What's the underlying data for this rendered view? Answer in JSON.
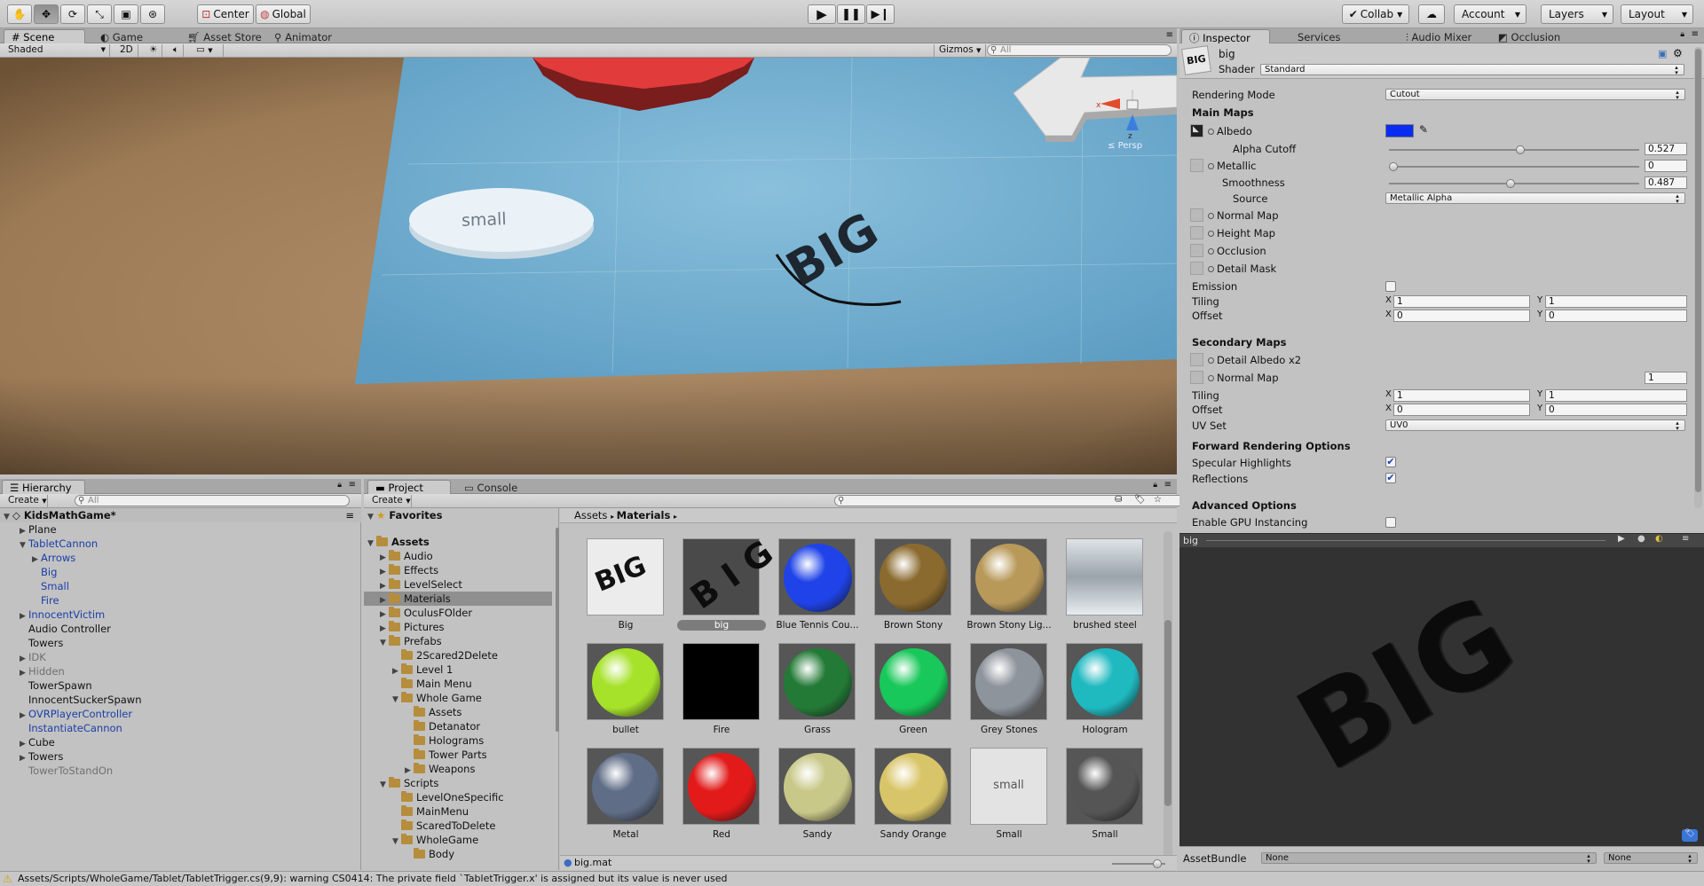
{
  "toolbar": {
    "pivot": "Center",
    "space": "Global",
    "collab": "Collab",
    "account": "Account",
    "layers": "Layers",
    "layout": "Layout"
  },
  "scene": {
    "tabs": [
      "Scene",
      "Game",
      "Asset Store",
      "Animator"
    ],
    "shading": "Shaded",
    "mode_2d": "2D",
    "gizmos": "Gizmos",
    "search_placeholder": "All",
    "persp_label": "Persp",
    "axis_x": "x",
    "axis_z": "z",
    "text_small": "small",
    "text_big": "BIG"
  },
  "hierarchy": {
    "tab": "Hierarchy",
    "create": "Create",
    "search_placeholder": "All",
    "root": "KidsMathGame*",
    "items": [
      {
        "label": "Plane",
        "level": 1,
        "arrow": "closed",
        "style": ""
      },
      {
        "label": "TabletCannon",
        "level": 1,
        "arrow": "open",
        "style": "blue"
      },
      {
        "label": "Arrows",
        "level": 2,
        "arrow": "closed",
        "style": "blue"
      },
      {
        "label": "Big",
        "level": 2,
        "arrow": "",
        "style": "blue"
      },
      {
        "label": "Small",
        "level": 2,
        "arrow": "",
        "style": "blue"
      },
      {
        "label": "Fire",
        "level": 2,
        "arrow": "",
        "style": "blue"
      },
      {
        "label": "InnocentVictim",
        "level": 1,
        "arrow": "closed",
        "style": "blue"
      },
      {
        "label": "Audio Controller",
        "level": 1,
        "arrow": "",
        "style": ""
      },
      {
        "label": "Towers",
        "level": 1,
        "arrow": "",
        "style": ""
      },
      {
        "label": "IDK",
        "level": 1,
        "arrow": "closed",
        "style": "grey"
      },
      {
        "label": "Hidden",
        "level": 1,
        "arrow": "closed",
        "style": "grey"
      },
      {
        "label": "TowerSpawn",
        "level": 1,
        "arrow": "",
        "style": ""
      },
      {
        "label": "InnocentSuckerSpawn",
        "level": 1,
        "arrow": "",
        "style": ""
      },
      {
        "label": "OVRPlayerController",
        "level": 1,
        "arrow": "closed",
        "style": "blue"
      },
      {
        "label": "InstantiateCannon",
        "level": 1,
        "arrow": "",
        "style": "blue"
      },
      {
        "label": "Cube",
        "level": 1,
        "arrow": "closed",
        "style": ""
      },
      {
        "label": "Towers",
        "level": 1,
        "arrow": "closed",
        "style": ""
      },
      {
        "label": "TowerToStandOn",
        "level": 1,
        "arrow": "",
        "style": "grey"
      }
    ]
  },
  "project": {
    "tabs": [
      "Project",
      "Console"
    ],
    "create": "Create",
    "favorites": "Favorites",
    "assets": "Assets",
    "tree": [
      {
        "label": "Audio",
        "level": 1,
        "arrow": "closed"
      },
      {
        "label": "Effects",
        "level": 1,
        "arrow": "closed"
      },
      {
        "label": "LevelSelect",
        "level": 1,
        "arrow": "closed"
      },
      {
        "label": "Materials",
        "level": 1,
        "arrow": "closed",
        "selected": true
      },
      {
        "label": "OculusFOlder",
        "level": 1,
        "arrow": "closed"
      },
      {
        "label": "Pictures",
        "level": 1,
        "arrow": "closed"
      },
      {
        "label": "Prefabs",
        "level": 1,
        "arrow": "open"
      },
      {
        "label": "2Scared2Delete",
        "level": 2,
        "arrow": ""
      },
      {
        "label": "Level 1",
        "level": 2,
        "arrow": "closed"
      },
      {
        "label": "Main Menu",
        "level": 2,
        "arrow": ""
      },
      {
        "label": "Whole Game",
        "level": 2,
        "arrow": "open"
      },
      {
        "label": "Assets",
        "level": 3,
        "arrow": ""
      },
      {
        "label": "Detanator",
        "level": 3,
        "arrow": ""
      },
      {
        "label": "Holograms",
        "level": 3,
        "arrow": ""
      },
      {
        "label": "Tower Parts",
        "level": 3,
        "arrow": ""
      },
      {
        "label": "Weapons",
        "level": 3,
        "arrow": "closed"
      },
      {
        "label": "Scripts",
        "level": 1,
        "arrow": "open"
      },
      {
        "label": "LevelOneSpecific",
        "level": 2,
        "arrow": ""
      },
      {
        "label": "MainMenu",
        "level": 2,
        "arrow": ""
      },
      {
        "label": "ScaredToDelete",
        "level": 2,
        "arrow": ""
      },
      {
        "label": "WholeGame",
        "level": 2,
        "arrow": "open"
      },
      {
        "label": "Body",
        "level": 3,
        "arrow": ""
      }
    ],
    "breadcrumb": [
      "Assets",
      "Materials"
    ],
    "materials": [
      {
        "label": "Big",
        "kind": "bigtext"
      },
      {
        "label": "big",
        "kind": "bigdark",
        "selected": true
      },
      {
        "label": "Blue Tennis Cou...",
        "color": "#1f43e8"
      },
      {
        "label": "Brown Stony",
        "color": "#8a6a2e"
      },
      {
        "label": "Brown Stony Lig...",
        "color": "#b8995a"
      },
      {
        "label": "brushed steel",
        "kind": "steel"
      },
      {
        "label": "bullet",
        "color": "#a6e22a"
      },
      {
        "label": "Fire",
        "kind": "black"
      },
      {
        "label": "Grass",
        "color": "#237a36"
      },
      {
        "label": "Green",
        "color": "#19c85a"
      },
      {
        "label": "Grey Stones",
        "color": "#8e949c"
      },
      {
        "label": "Hologram",
        "color": "#1fb9c0"
      },
      {
        "label": "Metal",
        "color": "#5f6d86"
      },
      {
        "label": "Red",
        "color": "#e21a1a"
      },
      {
        "label": "Sandy",
        "color": "#c8c889"
      },
      {
        "label": "Sandy Orange",
        "color": "#d9c569"
      },
      {
        "label": "Small",
        "kind": "smalltext"
      },
      {
        "label": "Small",
        "color": "#555555"
      }
    ],
    "selected_file": "big.mat"
  },
  "inspector": {
    "tabs": [
      "Inspector",
      "Services",
      "Audio Mixer",
      "Occlusion"
    ],
    "name": "big",
    "shader_label": "Shader",
    "shader": "Standard",
    "rendering_mode_label": "Rendering Mode",
    "rendering_mode": "Cutout",
    "main_maps": "Main Maps",
    "albedo": "Albedo",
    "albedo_color": "#0a2cf2",
    "alpha_cutoff_label": "Alpha Cutoff",
    "alpha_cutoff": "0.527",
    "alpha_cutoff_fraction": 0.527,
    "metallic_label": "Metallic",
    "metallic": "0",
    "metallic_fraction": 0,
    "smoothness_label": "Smoothness",
    "smoothness": "0.487",
    "smoothness_fraction": 0.487,
    "source_label": "Source",
    "source": "Metallic Alpha",
    "normal_map": "Normal Map",
    "height_map": "Height Map",
    "occlusion": "Occlusion",
    "detail_mask": "Detail Mask",
    "emission": "Emission",
    "tiling": "Tiling",
    "offset": "Offset",
    "tiling_x": "1",
    "tiling_y": "1",
    "offset_x": "0",
    "offset_y": "0",
    "secondary_maps": "Secondary Maps",
    "detail_albedo": "Detail Albedo x2",
    "normal_map2": "Normal Map",
    "normal_scale": "1",
    "tiling2_x": "1",
    "tiling2_y": "1",
    "offset2_x": "0",
    "offset2_y": "0",
    "uv_set_label": "UV Set",
    "uv_set": "UV0",
    "forward_rendering": "Forward Rendering Options",
    "specular": "Specular Highlights",
    "reflections": "Reflections",
    "advanced": "Advanced Options",
    "gpu_instancing": "Enable GPU Instancing",
    "x": "X",
    "y": "Y"
  },
  "preview": {
    "title": "big",
    "assetbundle_label": "AssetBundle",
    "bundle_name": "None",
    "bundle_variant": "None",
    "text": "BIG"
  },
  "status": {
    "message": "Assets/Scripts/WholeGame/Tablet/TabletTrigger.cs(9,9): warning CS0414: The private field `TabletTrigger.x' is assigned but its value is never used"
  }
}
